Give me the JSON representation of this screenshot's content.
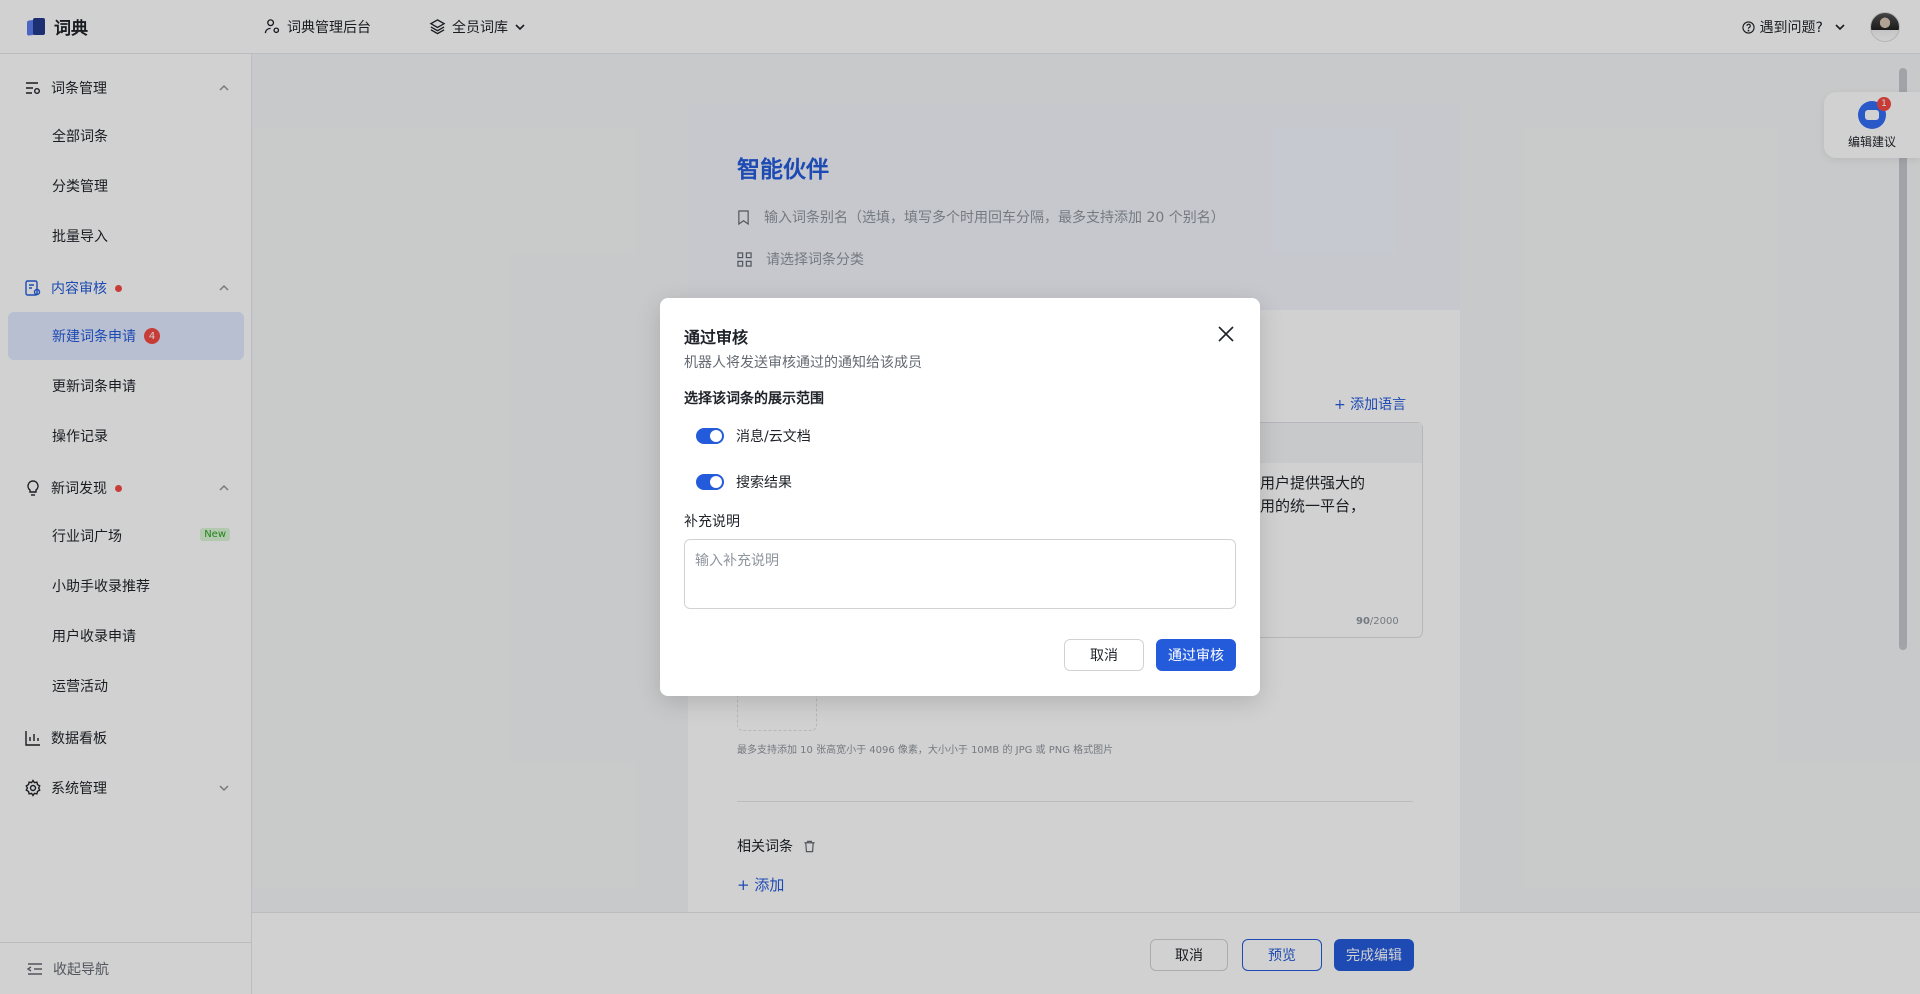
{
  "header": {
    "brand": "词典",
    "nav": [
      {
        "label": "词典管理后台"
      },
      {
        "label": "全员词库"
      }
    ],
    "help": "遇到问题?"
  },
  "sidebar": {
    "groups": [
      {
        "label": "词条管理",
        "items": [
          "全部词条",
          "分类管理",
          "批量导入"
        ]
      },
      {
        "label": "内容审核",
        "items": [
          "新建词条申请",
          "更新词条申请",
          "操作记录"
        ],
        "active_item": "新建词条申请",
        "badge": "4"
      },
      {
        "label": "新词发现",
        "items": [
          "行业词广场",
          "小助手收录推荐",
          "用户收录申请",
          "运营活动"
        ],
        "tag": "New"
      },
      {
        "label": "数据看板"
      },
      {
        "label": "系统管理"
      }
    ],
    "collapse": "收起导航"
  },
  "editor": {
    "title": "智能伙伴",
    "alias_placeholder": "输入词条别名（选填，填写多个时用回车分隔，最多支持添加 20 个别名）",
    "category_placeholder": "请选择词条分类",
    "add_language": "+ 添加语言",
    "desc_visible": "为用户提供强大的\n应用的统一平台，",
    "counter_current": "90",
    "counter_total": "/2000",
    "upload_hint": "最多支持添加 10 张高宽小于 4096 像素，大小小于 10MB 的 JPG 或 PNG 格式图片",
    "related_label": "相关词条",
    "add_related": "+ 添加"
  },
  "footer": {
    "cancel": "取消",
    "preview": "预览",
    "finish": "完成编辑"
  },
  "suggestion": {
    "label": "编辑建议",
    "count": "1"
  },
  "modal": {
    "title": "通过审核",
    "subtitle": "机器人将发送审核通过的通知给该成员",
    "section": "选择该词条的展示范围",
    "toggles": [
      {
        "label": "消息/云文档",
        "on": true
      },
      {
        "label": "搜索结果",
        "on": true
      }
    ],
    "note_label": "补充说明",
    "note_placeholder": "输入补充说明",
    "cancel": "取消",
    "approve": "通过审核"
  },
  "colors": {
    "accent": "#245bdb",
    "active_bg": "#e1eaff",
    "badge": "#f54a45"
  }
}
